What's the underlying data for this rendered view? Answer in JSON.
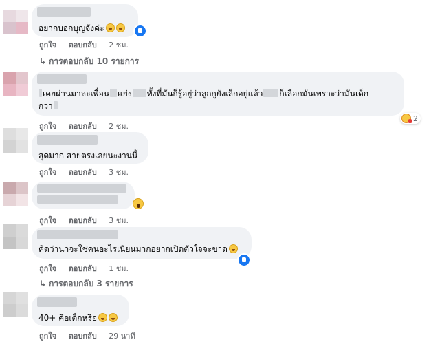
{
  "actions": {
    "like_label": "ถูกใจ",
    "reply_label": "ตอบกลับ"
  },
  "comments": [
    {
      "text": "อยากบอกบุญจังค่ะ",
      "time": "2 ชม."
    },
    {
      "text_parts": [
        "เคยผ่านมาละเพื่อน",
        "แย่ง",
        "ทั้งที่มันก็รู้อยู่ว่าลูกกูยังเล็กอยู่แล้ว",
        "ก็เลือกมันเพราะว่ามันเด็ก",
        "กว่า"
      ],
      "reaction_count": "2",
      "time": "2 ชม."
    },
    {
      "text": "สุดมาก สายตรงเลยนะงานนี้",
      "time": "3 ชม."
    },
    {
      "text": "",
      "time": "3 ชม."
    },
    {
      "text": "คิดว่าน่าจะใช่คนอะไรเนียนมากอยากเปิดตัวใจจะขาด",
      "time": "1 ชม."
    },
    {
      "text": "40+ คือเด็กหรือ",
      "time": "29 นาที"
    }
  ],
  "replies": [
    {
      "label": "การตอบกลับ 10 รายการ"
    },
    {
      "label": "การตอบกลับ 3 รายการ"
    }
  ],
  "icons": {
    "reply_arrow": "↳",
    "like": "like-icon",
    "grin": "grin-emoji-icon",
    "wow": "wow-emoji-icon",
    "care": "care-emoji-icon"
  },
  "colors": {
    "bubble": "#f0f2f5",
    "meta_text": "#65676b",
    "like_blue": "#1877f2"
  }
}
